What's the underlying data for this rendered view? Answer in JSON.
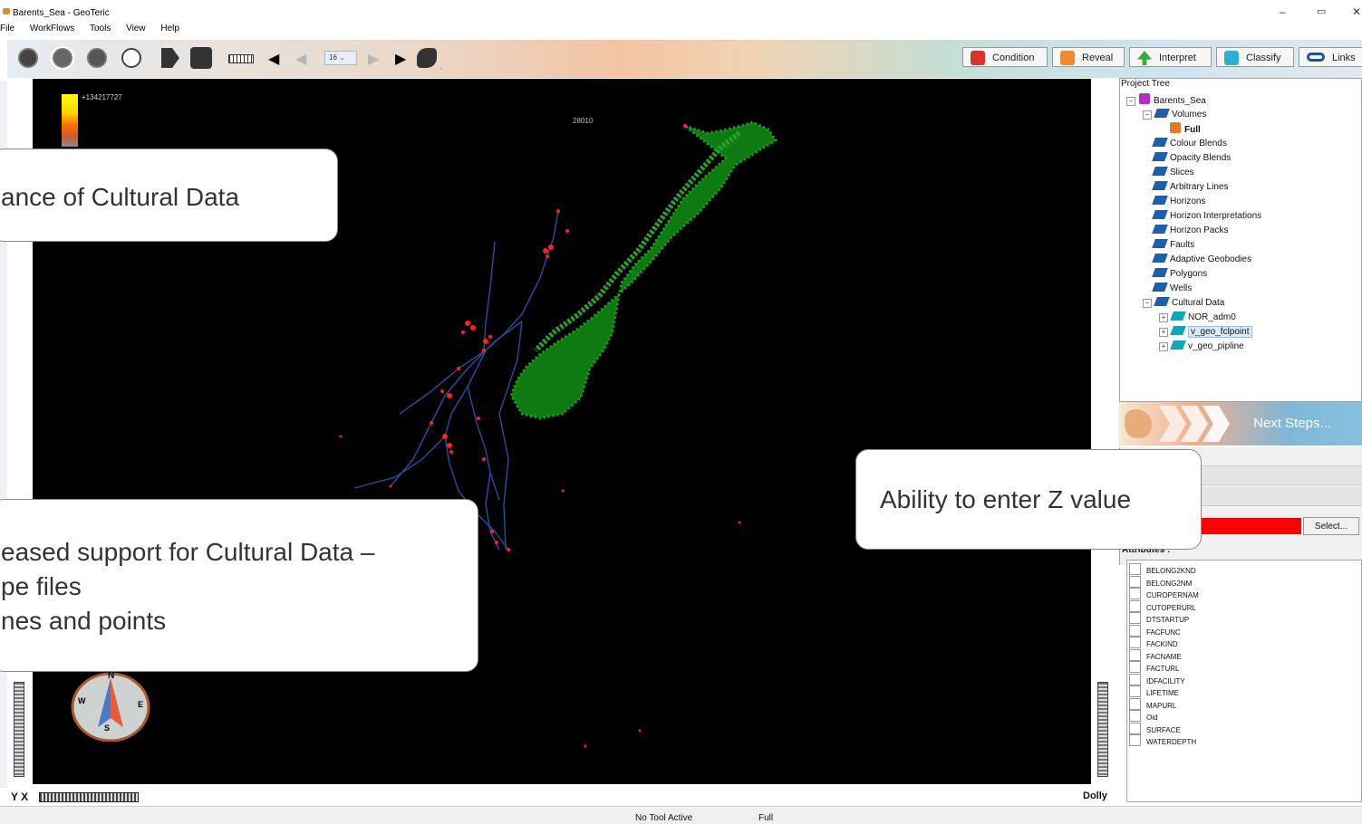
{
  "window": {
    "title": "Barents_Sea - GeoTeric",
    "minimize": "–",
    "restore": "▭",
    "close": "✕"
  },
  "menu": [
    "File",
    "WorkFlows",
    "Tools",
    "View",
    "Help"
  ],
  "toolbar": {
    "slice_combo": "16",
    "buttons": [
      "3d-view-icon",
      "select-icon",
      "rotate-icon",
      "pan-icon",
      "survey-icon",
      "camera-icon",
      "ruler-icon",
      "prev-icon",
      "first-icon",
      "next-icon",
      "play-icon",
      "movie-icon"
    ]
  },
  "workflow": [
    {
      "label": "Condition",
      "color": "#d8352a"
    },
    {
      "label": "Reveal",
      "color": "#f08a2e"
    },
    {
      "label": "Interpret",
      "color": "#3aa83a"
    },
    {
      "label": "Classify",
      "color": "#30b0d0"
    },
    {
      "label": "Links",
      "color": "#1b4fa0"
    }
  ],
  "viewport": {
    "scale_max": "+134217727",
    "coord": "28010",
    "z_label": "Dolly",
    "axis_label": "Y X"
  },
  "project_tree": {
    "title": "Project Tree",
    "items": [
      {
        "label": "Barents_Sea",
        "level": 0,
        "icon": "cube"
      },
      {
        "label": "Volumes",
        "level": 1,
        "icon": "folder"
      },
      {
        "label": "Full",
        "level": 2,
        "icon": "full",
        "bold": true
      },
      {
        "label": "Colour Blends",
        "level": 1,
        "icon": "folder"
      },
      {
        "label": "Opacity Blends",
        "level": 1,
        "icon": "folder"
      },
      {
        "label": "Slices",
        "level": 1,
        "icon": "folder"
      },
      {
        "label": "Arbitrary Lines",
        "level": 1,
        "icon": "folder"
      },
      {
        "label": "Horizons",
        "level": 1,
        "icon": "folder"
      },
      {
        "label": "Horizon Interpretations",
        "level": 1,
        "icon": "folder"
      },
      {
        "label": "Horizon Packs",
        "level": 1,
        "icon": "folder"
      },
      {
        "label": "Faults",
        "level": 1,
        "icon": "folder"
      },
      {
        "label": "Adaptive Geobodies",
        "level": 1,
        "icon": "folder"
      },
      {
        "label": "Polygons",
        "level": 1,
        "icon": "folder"
      },
      {
        "label": "Wells",
        "level": 1,
        "icon": "folder"
      },
      {
        "label": "Cultural Data",
        "level": 1,
        "icon": "folder"
      },
      {
        "label": "NOR_adm0",
        "level": 2,
        "icon": "layer"
      },
      {
        "label": "v_geo_fclpoint",
        "level": 2,
        "icon": "layer",
        "selected": true
      },
      {
        "label": "v_geo_pipline",
        "level": 2,
        "icon": "layer"
      }
    ]
  },
  "next_steps": "Next Steps...",
  "properties": {
    "select_label": "Select...",
    "color_value": "#ff0000",
    "attributes_title": "Attributes :"
  },
  "attributes": [
    "BELONG2KND",
    "BELONG2NM",
    "CUROPERNAM",
    "CUTOPERURL",
    "DTSTARTUP",
    "FACFUNC",
    "FACKIND",
    "FACNAME",
    "FACTURL",
    "IDFACILITY",
    "LIFETIME",
    "MAPURL",
    "Oid",
    "SURFACE",
    "WATERDEPTH"
  ],
  "status": {
    "tool": "No Tool Active",
    "volume": "Full"
  },
  "callouts": {
    "top": "ance of Cultural Data",
    "z_value": "Ability to enter Z value",
    "support_lines": [
      "eased support for Cultural Data –",
      "pe files",
      "nes and points"
    ]
  },
  "compass": {
    "n": "N",
    "s": "S",
    "e": "E",
    "w": "W"
  }
}
